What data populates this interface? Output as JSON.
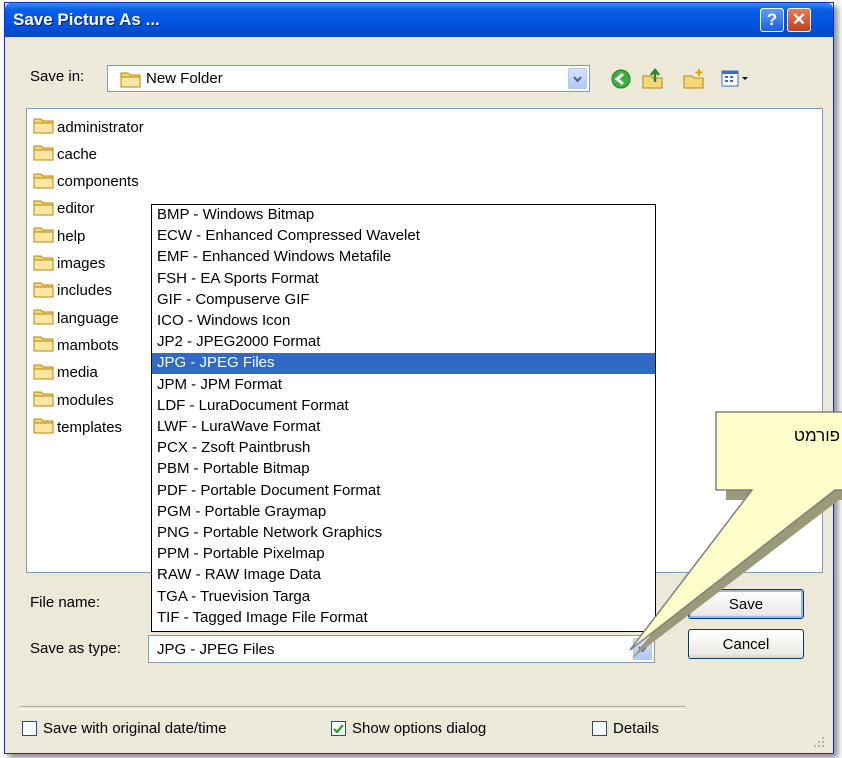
{
  "window": {
    "title": "Save Picture As ...",
    "help_glyph": "?",
    "close_glyph": "✕"
  },
  "save_in": {
    "label": "Save in:",
    "value": "New Folder"
  },
  "nav_icons": [
    "back-icon",
    "up-folder-icon",
    "new-folder-icon",
    "views-icon"
  ],
  "files": [
    "administrator",
    "cache",
    "components",
    "editor",
    "help",
    "images",
    "includes",
    "language",
    "mambots",
    "media",
    "modules",
    "templates"
  ],
  "file_name": {
    "label": "File name:",
    "value": ""
  },
  "save_as_type": {
    "label": "Save as type:",
    "value": "JPG - JPEG Files",
    "options": [
      "BMP - Windows Bitmap",
      "ECW - Enhanced Compressed Wavelet",
      "EMF - Enhanced Windows Metafile",
      "FSH - EA Sports Format",
      "GIF - Compuserve GIF",
      "ICO - Windows Icon",
      "JP2 - JPEG2000 Format",
      "JPG - JPEG Files",
      "JPM - JPM Format",
      "LDF - LuraDocument Format",
      "LWF - LuraWave Format",
      "PCX - Zsoft Paintbrush",
      "PBM - Portable Bitmap",
      "PDF - Portable Document Format",
      "PGM - Portable Graymap",
      "PNG - Portable Network Graphics",
      "PPM - Portable Pixelmap",
      "RAW - RAW Image Data",
      "TGA - Truevision Targa",
      "TIF - Tagged Image File Format"
    ],
    "selected_index": 7
  },
  "buttons": {
    "save": "Save",
    "cancel": "Cancel"
  },
  "checkboxes": {
    "original_date": {
      "label": "Save with original date/time",
      "checked": false
    },
    "show_options": {
      "label": "Show options dialog",
      "checked": true
    },
    "details": {
      "label": "Details",
      "checked": false
    }
  },
  "callout": {
    "text": "פורמט"
  },
  "colors": {
    "titlebar": "#0053e1",
    "selection": "#316ac5",
    "dialog_bg": "#ece9d8",
    "callout_fill": "#ffffcc"
  }
}
